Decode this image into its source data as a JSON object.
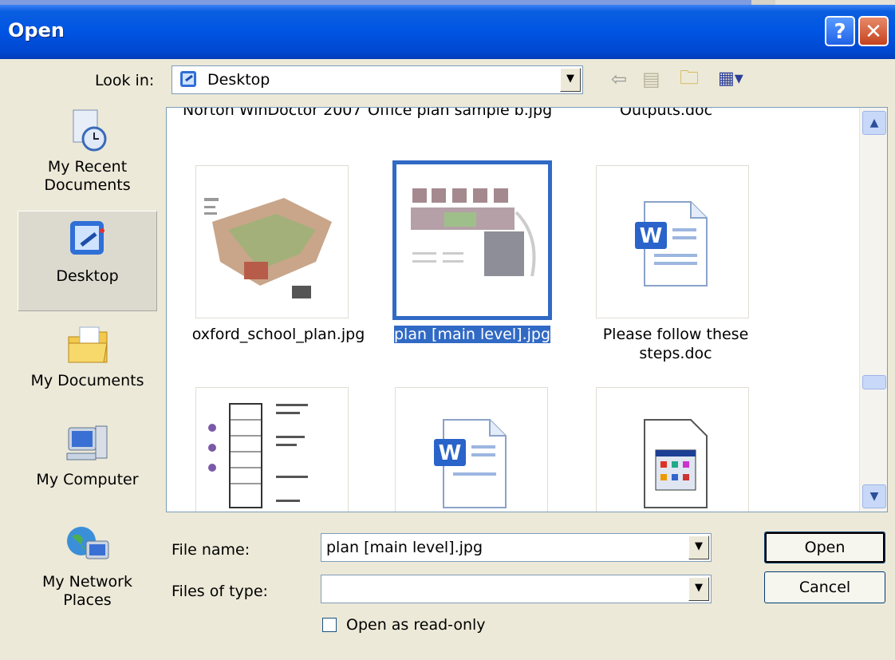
{
  "dialog": {
    "title": "Open"
  },
  "toolbar": {
    "look_in_label": "Look in:",
    "look_in_value": "Desktop"
  },
  "places": [
    {
      "label_line1": "My Recent",
      "label_line2": "Documents"
    },
    {
      "label_line1": "Desktop",
      "label_line2": ""
    },
    {
      "label_line1": "My Documents",
      "label_line2": ""
    },
    {
      "label_line1": "My Computer",
      "label_line2": ""
    },
    {
      "label_line1": "My Network",
      "label_line2": "Places"
    }
  ],
  "files": {
    "partial_row": [
      "Norton WinDoctor 2007",
      "Office plan sample b.jpg",
      "Outputs.doc"
    ],
    "row1": [
      {
        "name": "oxford_school_plan.jpg",
        "name2": ""
      },
      {
        "name": "plan [main level].jpg",
        "name2": ""
      },
      {
        "name": "Please follow these",
        "name2": "steps.doc"
      }
    ]
  },
  "form": {
    "file_name_label": "File name:",
    "file_name_value": "plan [main level].jpg",
    "files_of_type_label": "Files of type:",
    "files_of_type_value": "",
    "read_only_label": "Open as read-only"
  },
  "buttons": {
    "open": "Open",
    "cancel": "Cancel"
  }
}
